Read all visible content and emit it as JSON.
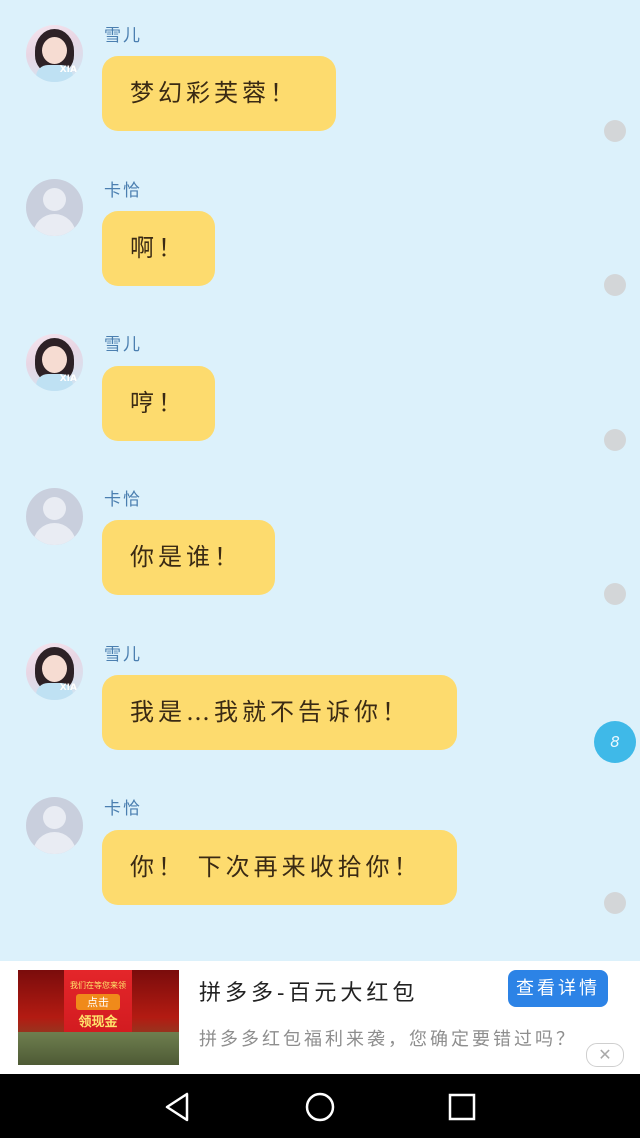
{
  "messages": [
    {
      "sender": "雪儿",
      "avatar": "girl",
      "text": "梦幻彩芙蓉！"
    },
    {
      "sender": "卡恰",
      "avatar": "default",
      "text": "啊！"
    },
    {
      "sender": "雪儿",
      "avatar": "girl",
      "text": "哼！"
    },
    {
      "sender": "卡恰",
      "avatar": "default",
      "text": "你是谁！"
    },
    {
      "sender": "雪儿",
      "avatar": "girl",
      "text": "我是…我就不告诉你！"
    },
    {
      "sender": "卡恰",
      "avatar": "default",
      "text": "你！ 下次再来收拾你！"
    }
  ],
  "unread_badge": "8",
  "ad": {
    "image_text_top": "我们在等您来领",
    "image_text_click": "点击",
    "image_text_cash": "领现金",
    "title": "拼多多-百元大红包",
    "subtitle": "拼多多红包福利来袭，您确定要错过吗？",
    "button_label": "查看详情",
    "close_glyph": "✕"
  },
  "navbar": {
    "icons": [
      "back-icon",
      "home-icon",
      "recent-apps-icon"
    ]
  },
  "colors": {
    "background": "#dcf1fb",
    "bubble": "#fddb6e",
    "name": "#4b7fb0",
    "badge": "#3fb9e8",
    "ad_button": "#2c83e6"
  }
}
